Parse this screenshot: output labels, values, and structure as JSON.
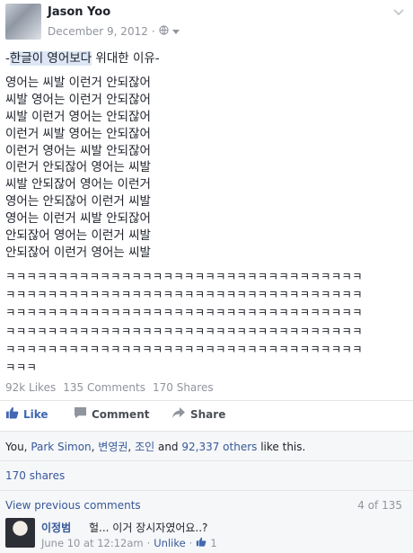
{
  "post": {
    "author": "Jason Yoo",
    "date": "December 9, 2012",
    "dot": "·",
    "title_prefix": "-",
    "title_highlight": "한글이 영어보다",
    "title_suffix": " 위대한 이유-",
    "poem": [
      "영어는 씨발 이런거 안되잖어",
      "씨발 영어는 이런거 안되잖어",
      "씨발 이런거 영어는 안되잖어",
      "이런거 씨발 영어는 안되잖어",
      "이런거 영어는 씨발 안되잖어",
      "이런거 안되잖어 영어는 씨발",
      "씨발 안되잖어 영어는 이런거",
      "영어는 안되잖어 이런거 씨발",
      "영어는 이런거 씨발 안되잖어",
      "안되잖어 영어는 이런거 씨발",
      "안되잖어 이런거 영어는 씨발"
    ],
    "laughter": [
      "ㅋㅋㅋㅋㅋㅋㅋㅋㅋㅋㅋㅋㅋㅋㅋㅋㅋㅋㅋㅋㅋㅋㅋㅋㅋㅋㅋㅋㅋㅋㅋㅋㅋㅋ",
      "ㅋㅋㅋㅋㅋㅋㅋㅋㅋㅋㅋㅋㅋㅋㅋㅋㅋㅋㅋㅋㅋㅋㅋㅋㅋㅋㅋㅋㅋㅋㅋㅋㅋㅋ",
      "ㅋㅋㅋㅋㅋㅋㅋㅋㅋㅋㅋㅋㅋㅋㅋㅋㅋㅋㅋㅋㅋㅋㅋㅋㅋㅋㅋㅋㅋㅋㅋㅋㅋㅋ",
      "ㅋㅋㅋㅋㅋㅋㅋㅋㅋㅋㅋㅋㅋㅋㅋㅋㅋㅋㅋㅋㅋㅋㅋㅋㅋㅋㅋㅋㅋㅋㅋㅋㅋㅋ",
      "ㅋㅋㅋㅋㅋㅋㅋㅋㅋㅋㅋㅋㅋㅋㅋㅋㅋㅋㅋㅋㅋㅋㅋㅋㅋㅋㅋㅋㅋㅋㅋㅋㅋㅋ",
      "ㅋㅋㅋ"
    ]
  },
  "stats": {
    "likes": "92k Likes",
    "comments": "135 Comments",
    "shares": "170 Shares"
  },
  "actions": {
    "like": "Like",
    "comment": "Comment",
    "share": "Share",
    "like_color": "#4267b2"
  },
  "likers": {
    "prefix": "You, ",
    "name1": "Park Simon",
    "sep1": ", ",
    "name2": "변영권",
    "sep2": ", ",
    "name3": "조인",
    "and": " and ",
    "others": "92,337 others",
    "suffix": " like this."
  },
  "shares_line": "170 shares",
  "comments": {
    "view_previous": "View previous comments",
    "page_count": "4 of 135",
    "items": [
      {
        "name": "이정범",
        "text": "헐... 이거 장시자였어요..?",
        "time": "June 10 at 12:12am",
        "sep": "·",
        "unlike": "Unlike",
        "likes": "1"
      }
    ]
  },
  "icons": {
    "privacy": "globe-icon",
    "menu": "chevron-down-icon",
    "like": "thumbs-up-icon",
    "comment": "comment-icon",
    "share": "share-arrow-icon"
  }
}
